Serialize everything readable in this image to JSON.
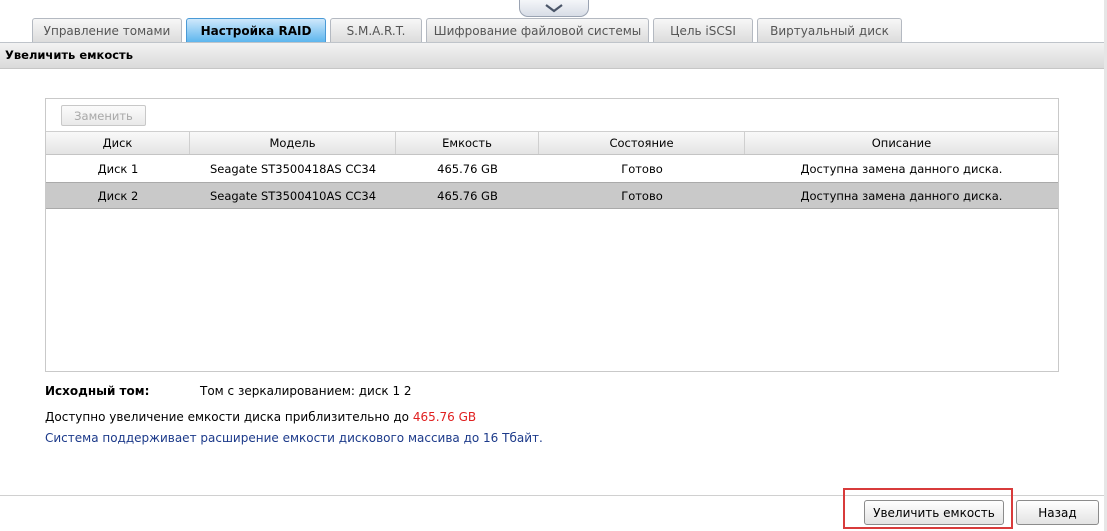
{
  "tabs": [
    {
      "label": "Управление томами",
      "active": false
    },
    {
      "label": "Настройка RAID",
      "active": true
    },
    {
      "label": "S.M.A.R.T.",
      "active": false
    },
    {
      "label": "Шифрование файловой системы",
      "active": false
    },
    {
      "label": "Цель iSCSI",
      "active": false
    },
    {
      "label": "Виртуальный диск",
      "active": false
    }
  ],
  "section": {
    "title": "Увеличить емкость"
  },
  "toolbar": {
    "replace_label": "Заменить"
  },
  "table": {
    "columns": [
      "Диск",
      "Модель",
      "Емкость",
      "Состояние",
      "Описание"
    ],
    "rows": [
      {
        "disk": "Диск 1",
        "model": "Seagate ST3500418AS CC34",
        "capacity": "465.76 GB",
        "status": "Готово",
        "description": "Доступна замена данного диска.",
        "selected": false
      },
      {
        "disk": "Диск 2",
        "model": "Seagate ST3500410AS CC34",
        "capacity": "465.76 GB",
        "status": "Готово",
        "description": "Доступна замена данного диска.",
        "selected": true
      }
    ]
  },
  "info": {
    "source_label": "Исходный том:",
    "source_value": "Том с зеркалированием: диск 1 2",
    "expand_text": "Доступно увеличение емкости диска приблизительно до",
    "expand_value": "465.76 GB",
    "support_text": "Система поддерживает расширение емкости дискового массива до 16 Тбайт."
  },
  "buttons": {
    "expand_label": "Увеличить емкость",
    "back_label": "Назад"
  },
  "colors": {
    "active_tab": "#5eb6ee",
    "highlight": "#d83b3b",
    "value_red": "#e02020",
    "note_blue": "#1c3a8a"
  }
}
